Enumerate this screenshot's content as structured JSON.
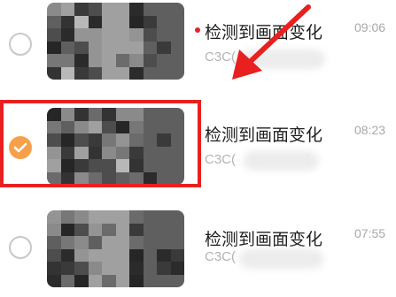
{
  "items": [
    {
      "title": "检测到画面变化",
      "subtitle": "C3C(",
      "time": "09:06",
      "unread": true,
      "selected": false
    },
    {
      "title": "检测到画面变化",
      "subtitle": "C3C(",
      "subtitle_end": ")",
      "time": "08:23",
      "unread": false,
      "selected": true
    },
    {
      "title": "检测到画面变化",
      "subtitle": "C3C(",
      "time": "07:55",
      "unread": false,
      "selected": false
    }
  ],
  "colors": {
    "accent": "#f6a14a",
    "highlight": "#e8201f",
    "unread_dot": "#e5232b"
  },
  "icons": {
    "check": "check-icon",
    "arrow": "annotation-arrow-icon"
  }
}
